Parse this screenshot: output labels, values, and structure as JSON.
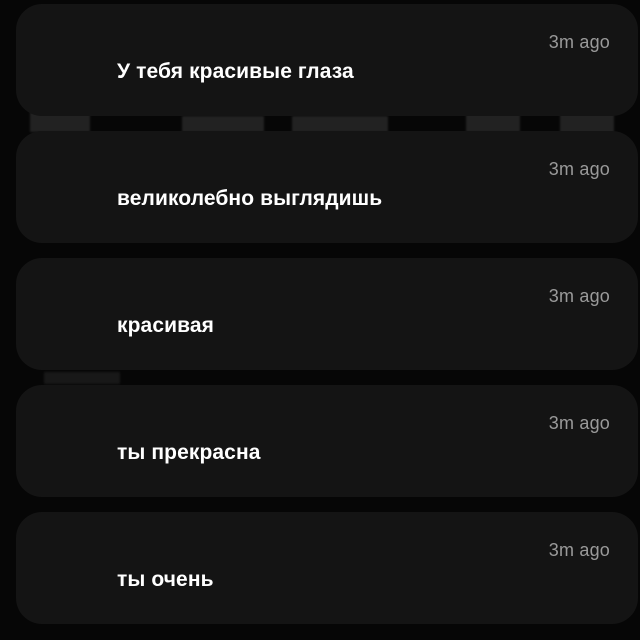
{
  "notifications": [
    {
      "message": "У тебя красивые глаза",
      "time": "3m ago"
    },
    {
      "message": "великолебно выглядишь",
      "time": "3m ago"
    },
    {
      "message": "красивая",
      "time": "3m ago"
    },
    {
      "message": "ты прекрасна",
      "time": "3m ago"
    },
    {
      "message": "ты очень",
      "time": "3m ago"
    }
  ],
  "colors": {
    "background": "#060606",
    "card": "#141414",
    "message_text": "#ffffff",
    "time_text": "#9a9a9a"
  }
}
